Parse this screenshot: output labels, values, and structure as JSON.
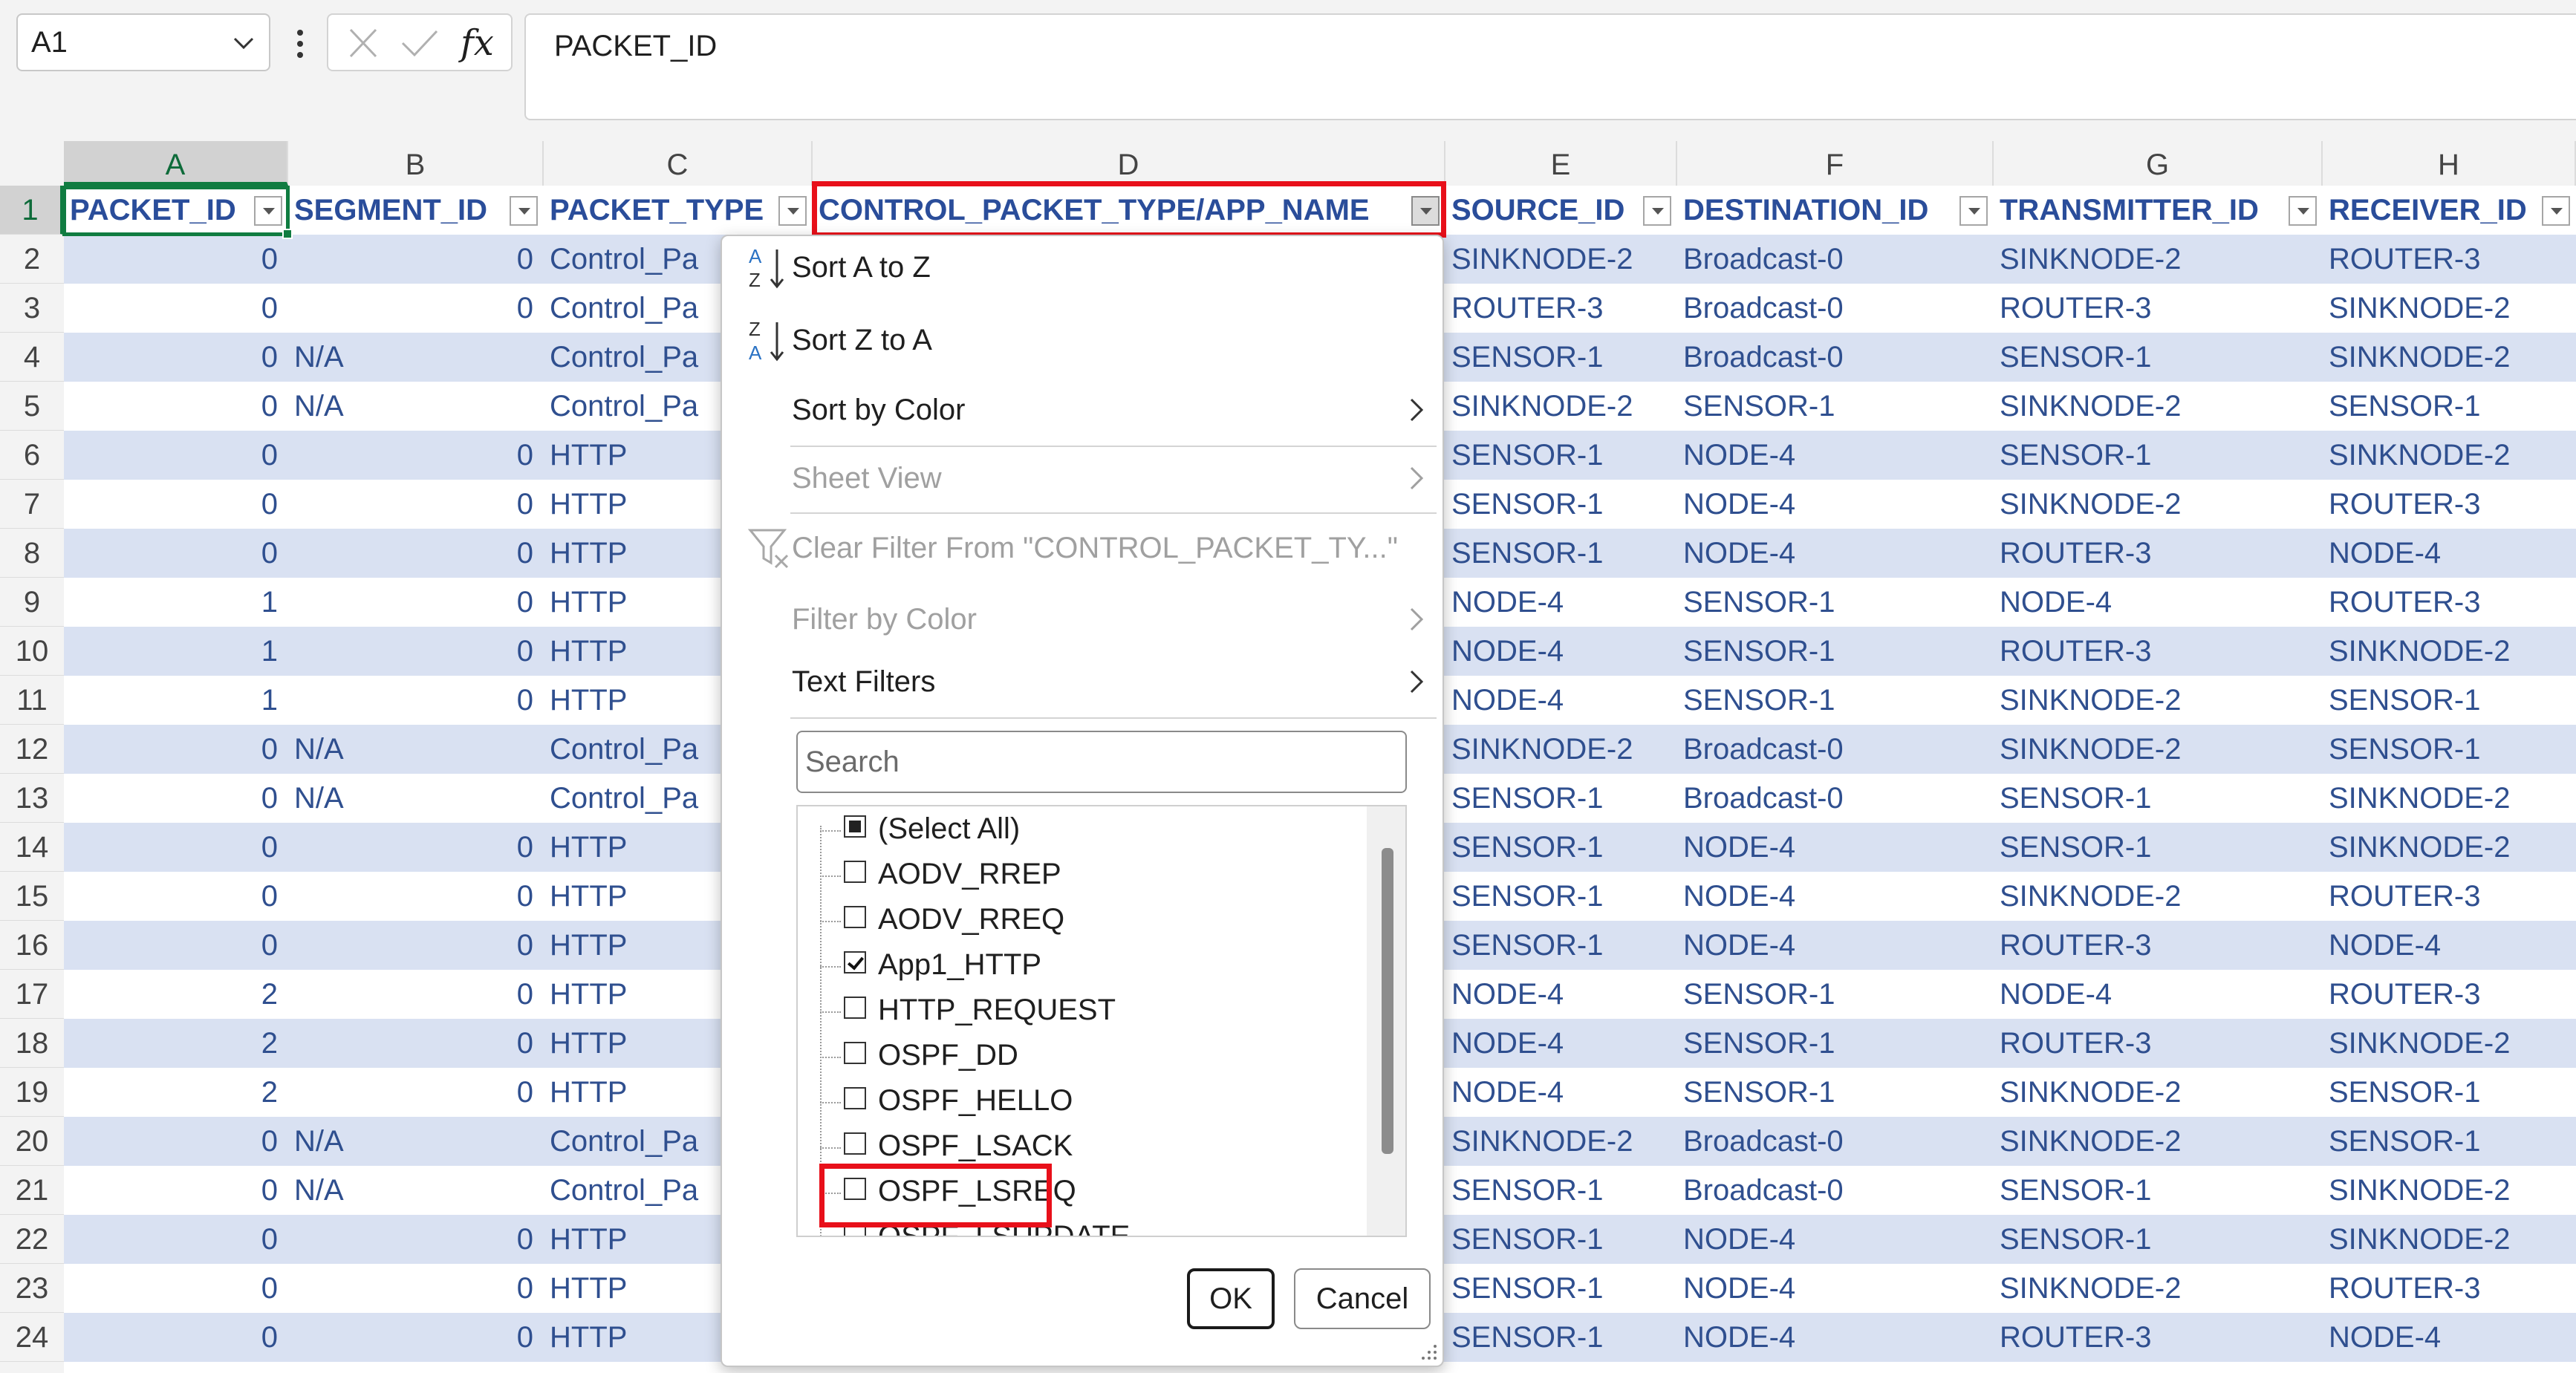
{
  "formula_bar": {
    "name_box": "A1",
    "fx": "fx",
    "content": "PACKET_ID"
  },
  "columns": [
    "A",
    "B",
    "C",
    "D",
    "E",
    "F",
    "G",
    "H"
  ],
  "headers": [
    "PACKET_ID",
    "SEGMENT_ID",
    "PACKET_TYPE",
    "CONTROL_PACKET_TYPE/APP_NAME",
    "SOURCE_ID",
    "DESTINATION_ID",
    "TRANSMITTER_ID",
    "RECEIVER_ID"
  ],
  "rows": [
    {
      "n": "2",
      "a": "0",
      "b": "0",
      "c": "Control_Pa",
      "e": "SINKNODE-2",
      "f": "Broadcast-0",
      "g": "SINKNODE-2",
      "h": "ROUTER-3"
    },
    {
      "n": "3",
      "a": "0",
      "b": "0",
      "c": "Control_Pa",
      "e": "ROUTER-3",
      "f": "Broadcast-0",
      "g": "ROUTER-3",
      "h": "SINKNODE-2"
    },
    {
      "n": "4",
      "a": "0",
      "b": "N/A",
      "c": "Control_Pa",
      "e": "SENSOR-1",
      "f": "Broadcast-0",
      "g": "SENSOR-1",
      "h": "SINKNODE-2"
    },
    {
      "n": "5",
      "a": "0",
      "b": "N/A",
      "c": "Control_Pa",
      "e": "SINKNODE-2",
      "f": "SENSOR-1",
      "g": "SINKNODE-2",
      "h": "SENSOR-1"
    },
    {
      "n": "6",
      "a": "0",
      "b": "0",
      "c": "HTTP",
      "e": "SENSOR-1",
      "f": "NODE-4",
      "g": "SENSOR-1",
      "h": "SINKNODE-2"
    },
    {
      "n": "7",
      "a": "0",
      "b": "0",
      "c": "HTTP",
      "e": "SENSOR-1",
      "f": "NODE-4",
      "g": "SINKNODE-2",
      "h": "ROUTER-3"
    },
    {
      "n": "8",
      "a": "0",
      "b": "0",
      "c": "HTTP",
      "e": "SENSOR-1",
      "f": "NODE-4",
      "g": "ROUTER-3",
      "h": "NODE-4"
    },
    {
      "n": "9",
      "a": "1",
      "b": "0",
      "c": "HTTP",
      "e": "NODE-4",
      "f": "SENSOR-1",
      "g": "NODE-4",
      "h": "ROUTER-3"
    },
    {
      "n": "10",
      "a": "1",
      "b": "0",
      "c": "HTTP",
      "e": "NODE-4",
      "f": "SENSOR-1",
      "g": "ROUTER-3",
      "h": "SINKNODE-2"
    },
    {
      "n": "11",
      "a": "1",
      "b": "0",
      "c": "HTTP",
      "e": "NODE-4",
      "f": "SENSOR-1",
      "g": "SINKNODE-2",
      "h": "SENSOR-1"
    },
    {
      "n": "12",
      "a": "0",
      "b": "N/A",
      "c": "Control_Pa",
      "e": "SINKNODE-2",
      "f": "Broadcast-0",
      "g": "SINKNODE-2",
      "h": "SENSOR-1"
    },
    {
      "n": "13",
      "a": "0",
      "b": "N/A",
      "c": "Control_Pa",
      "e": "SENSOR-1",
      "f": "Broadcast-0",
      "g": "SENSOR-1",
      "h": "SINKNODE-2"
    },
    {
      "n": "14",
      "a": "0",
      "b": "0",
      "c": "HTTP",
      "e": "SENSOR-1",
      "f": "NODE-4",
      "g": "SENSOR-1",
      "h": "SINKNODE-2"
    },
    {
      "n": "15",
      "a": "0",
      "b": "0",
      "c": "HTTP",
      "e": "SENSOR-1",
      "f": "NODE-4",
      "g": "SINKNODE-2",
      "h": "ROUTER-3"
    },
    {
      "n": "16",
      "a": "0",
      "b": "0",
      "c": "HTTP",
      "e": "SENSOR-1",
      "f": "NODE-4",
      "g": "ROUTER-3",
      "h": "NODE-4"
    },
    {
      "n": "17",
      "a": "2",
      "b": "0",
      "c": "HTTP",
      "e": "NODE-4",
      "f": "SENSOR-1",
      "g": "NODE-4",
      "h": "ROUTER-3"
    },
    {
      "n": "18",
      "a": "2",
      "b": "0",
      "c": "HTTP",
      "e": "NODE-4",
      "f": "SENSOR-1",
      "g": "ROUTER-3",
      "h": "SINKNODE-2"
    },
    {
      "n": "19",
      "a": "2",
      "b": "0",
      "c": "HTTP",
      "e": "NODE-4",
      "f": "SENSOR-1",
      "g": "SINKNODE-2",
      "h": "SENSOR-1"
    },
    {
      "n": "20",
      "a": "0",
      "b": "N/A",
      "c": "Control_Pa",
      "e": "SINKNODE-2",
      "f": "Broadcast-0",
      "g": "SINKNODE-2",
      "h": "SENSOR-1"
    },
    {
      "n": "21",
      "a": "0",
      "b": "N/A",
      "c": "Control_Pa",
      "e": "SENSOR-1",
      "f": "Broadcast-0",
      "g": "SENSOR-1",
      "h": "SINKNODE-2"
    },
    {
      "n": "22",
      "a": "0",
      "b": "0",
      "c": "HTTP",
      "e": "SENSOR-1",
      "f": "NODE-4",
      "g": "SENSOR-1",
      "h": "SINKNODE-2"
    },
    {
      "n": "23",
      "a": "0",
      "b": "0",
      "c": "HTTP",
      "e": "SENSOR-1",
      "f": "NODE-4",
      "g": "SINKNODE-2",
      "h": "ROUTER-3"
    },
    {
      "n": "24",
      "a": "0",
      "b": "0",
      "c": "HTTP",
      "e": "SENSOR-1",
      "f": "NODE-4",
      "g": "ROUTER-3",
      "h": "NODE-4"
    }
  ],
  "filter_menu": {
    "sort_az": "Sort A to Z",
    "sort_za": "Sort Z to A",
    "sort_by_color": "Sort by Color",
    "sheet_view": "Sheet View",
    "clear_filter": "Clear Filter From \"CONTROL_PACKET_TY...\"",
    "filter_by_color": "Filter by Color",
    "text_filters": "Text Filters",
    "search_placeholder": "Search",
    "items": [
      {
        "label": "(Select All)",
        "state": "partial"
      },
      {
        "label": "AODV_RREP",
        "state": "unchecked"
      },
      {
        "label": "AODV_RREQ",
        "state": "unchecked"
      },
      {
        "label": "App1_HTTP",
        "state": "checked"
      },
      {
        "label": "HTTP_REQUEST",
        "state": "unchecked"
      },
      {
        "label": "OSPF_DD",
        "state": "unchecked"
      },
      {
        "label": "OSPF_HELLO",
        "state": "unchecked"
      },
      {
        "label": "OSPF_LSACK",
        "state": "unchecked"
      },
      {
        "label": "OSPF_LSREQ",
        "state": "unchecked"
      },
      {
        "label": "OSPF_LSUPDATE",
        "state": "unchecked"
      }
    ],
    "ok": "OK",
    "cancel": "Cancel"
  },
  "colors": {
    "band": "#d9e1f2",
    "header_text": "#2a4d9a",
    "selection": "#107c41",
    "highlight": "#e8101a"
  }
}
